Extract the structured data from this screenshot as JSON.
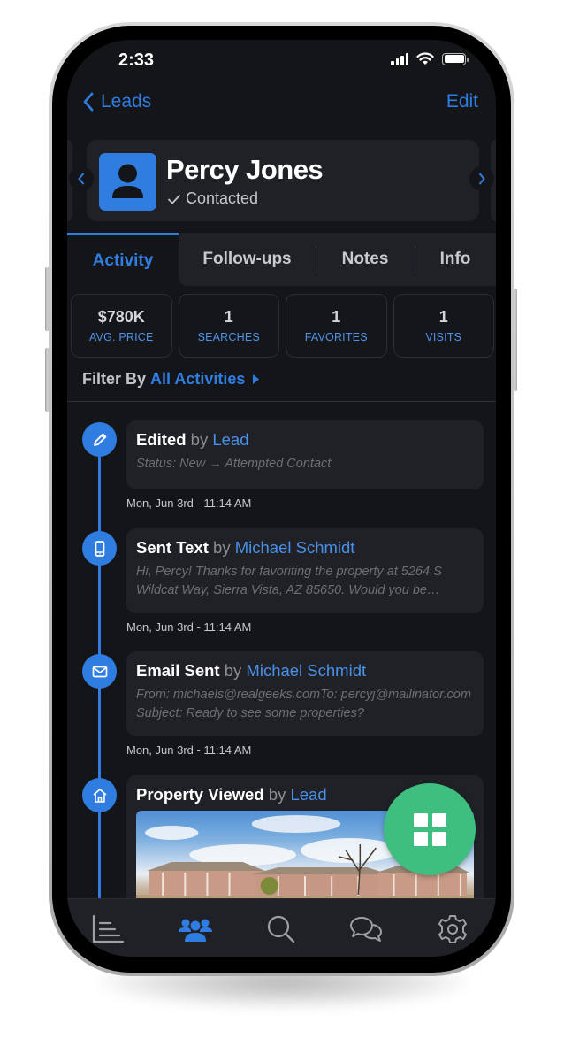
{
  "status_bar": {
    "time": "2:33",
    "icons": [
      "signal-icon",
      "wifi-icon",
      "battery-icon"
    ]
  },
  "nav": {
    "back_label": "Leads",
    "edit_label": "Edit"
  },
  "profile": {
    "name": "Percy Jones",
    "status": "Contacted",
    "status_icon": "checkmark-icon"
  },
  "tabs": [
    {
      "label": "Activity",
      "active": true
    },
    {
      "label": "Follow-ups",
      "active": false
    },
    {
      "label": "Notes",
      "active": false
    },
    {
      "label": "Info",
      "active": false
    }
  ],
  "stats": [
    {
      "value": "$780K",
      "label": "AVG. PRICE"
    },
    {
      "value": "1",
      "label": "SEARCHES"
    },
    {
      "value": "1",
      "label": "FAVORITES"
    },
    {
      "value": "1",
      "label": "VISITS"
    }
  ],
  "filter": {
    "label": "Filter By",
    "value": "All Activities"
  },
  "activities": [
    {
      "icon": "pencil-icon",
      "action": "Edited",
      "by": "by",
      "actor": "Lead",
      "body": "Status: New → Attempted Contact",
      "timestamp": "Mon, Jun 3rd - 11:14 AM"
    },
    {
      "icon": "phone-icon",
      "action": "Sent Text",
      "by": "by",
      "actor": "Michael Schmidt",
      "body": "Hi, Percy! Thanks for favoriting the property at 5264 S Wildcat Way, Sierra Vista, AZ 85650. Would you be interested in a showing?",
      "timestamp": "Mon, Jun 3rd - 11:14 AM"
    },
    {
      "icon": "envelope-icon",
      "action": "Email Sent",
      "by": "by",
      "actor": "Michael Schmidt",
      "body": "From: michaels@realgeeks.comTo: percyj@mailinator.comSubject: Ready to see some properties?",
      "timestamp": "Mon, Jun 3rd - 11:14 AM"
    },
    {
      "icon": "house-icon",
      "action": "Property Viewed",
      "by": "by",
      "actor": "Lead",
      "image": "property-photo"
    }
  ],
  "fab": {
    "icon": "grid-icon"
  },
  "bottom_nav": [
    {
      "icon": "chart-list-icon",
      "active": false
    },
    {
      "icon": "users-icon",
      "active": true
    },
    {
      "icon": "search-icon",
      "active": false
    },
    {
      "icon": "chat-bubbles-icon",
      "active": false
    },
    {
      "icon": "gear-icon",
      "active": false
    }
  ],
  "colors": {
    "accent": "#2f7de1",
    "fab": "#3ebf7f",
    "background": "#141518",
    "card": "#202127"
  }
}
